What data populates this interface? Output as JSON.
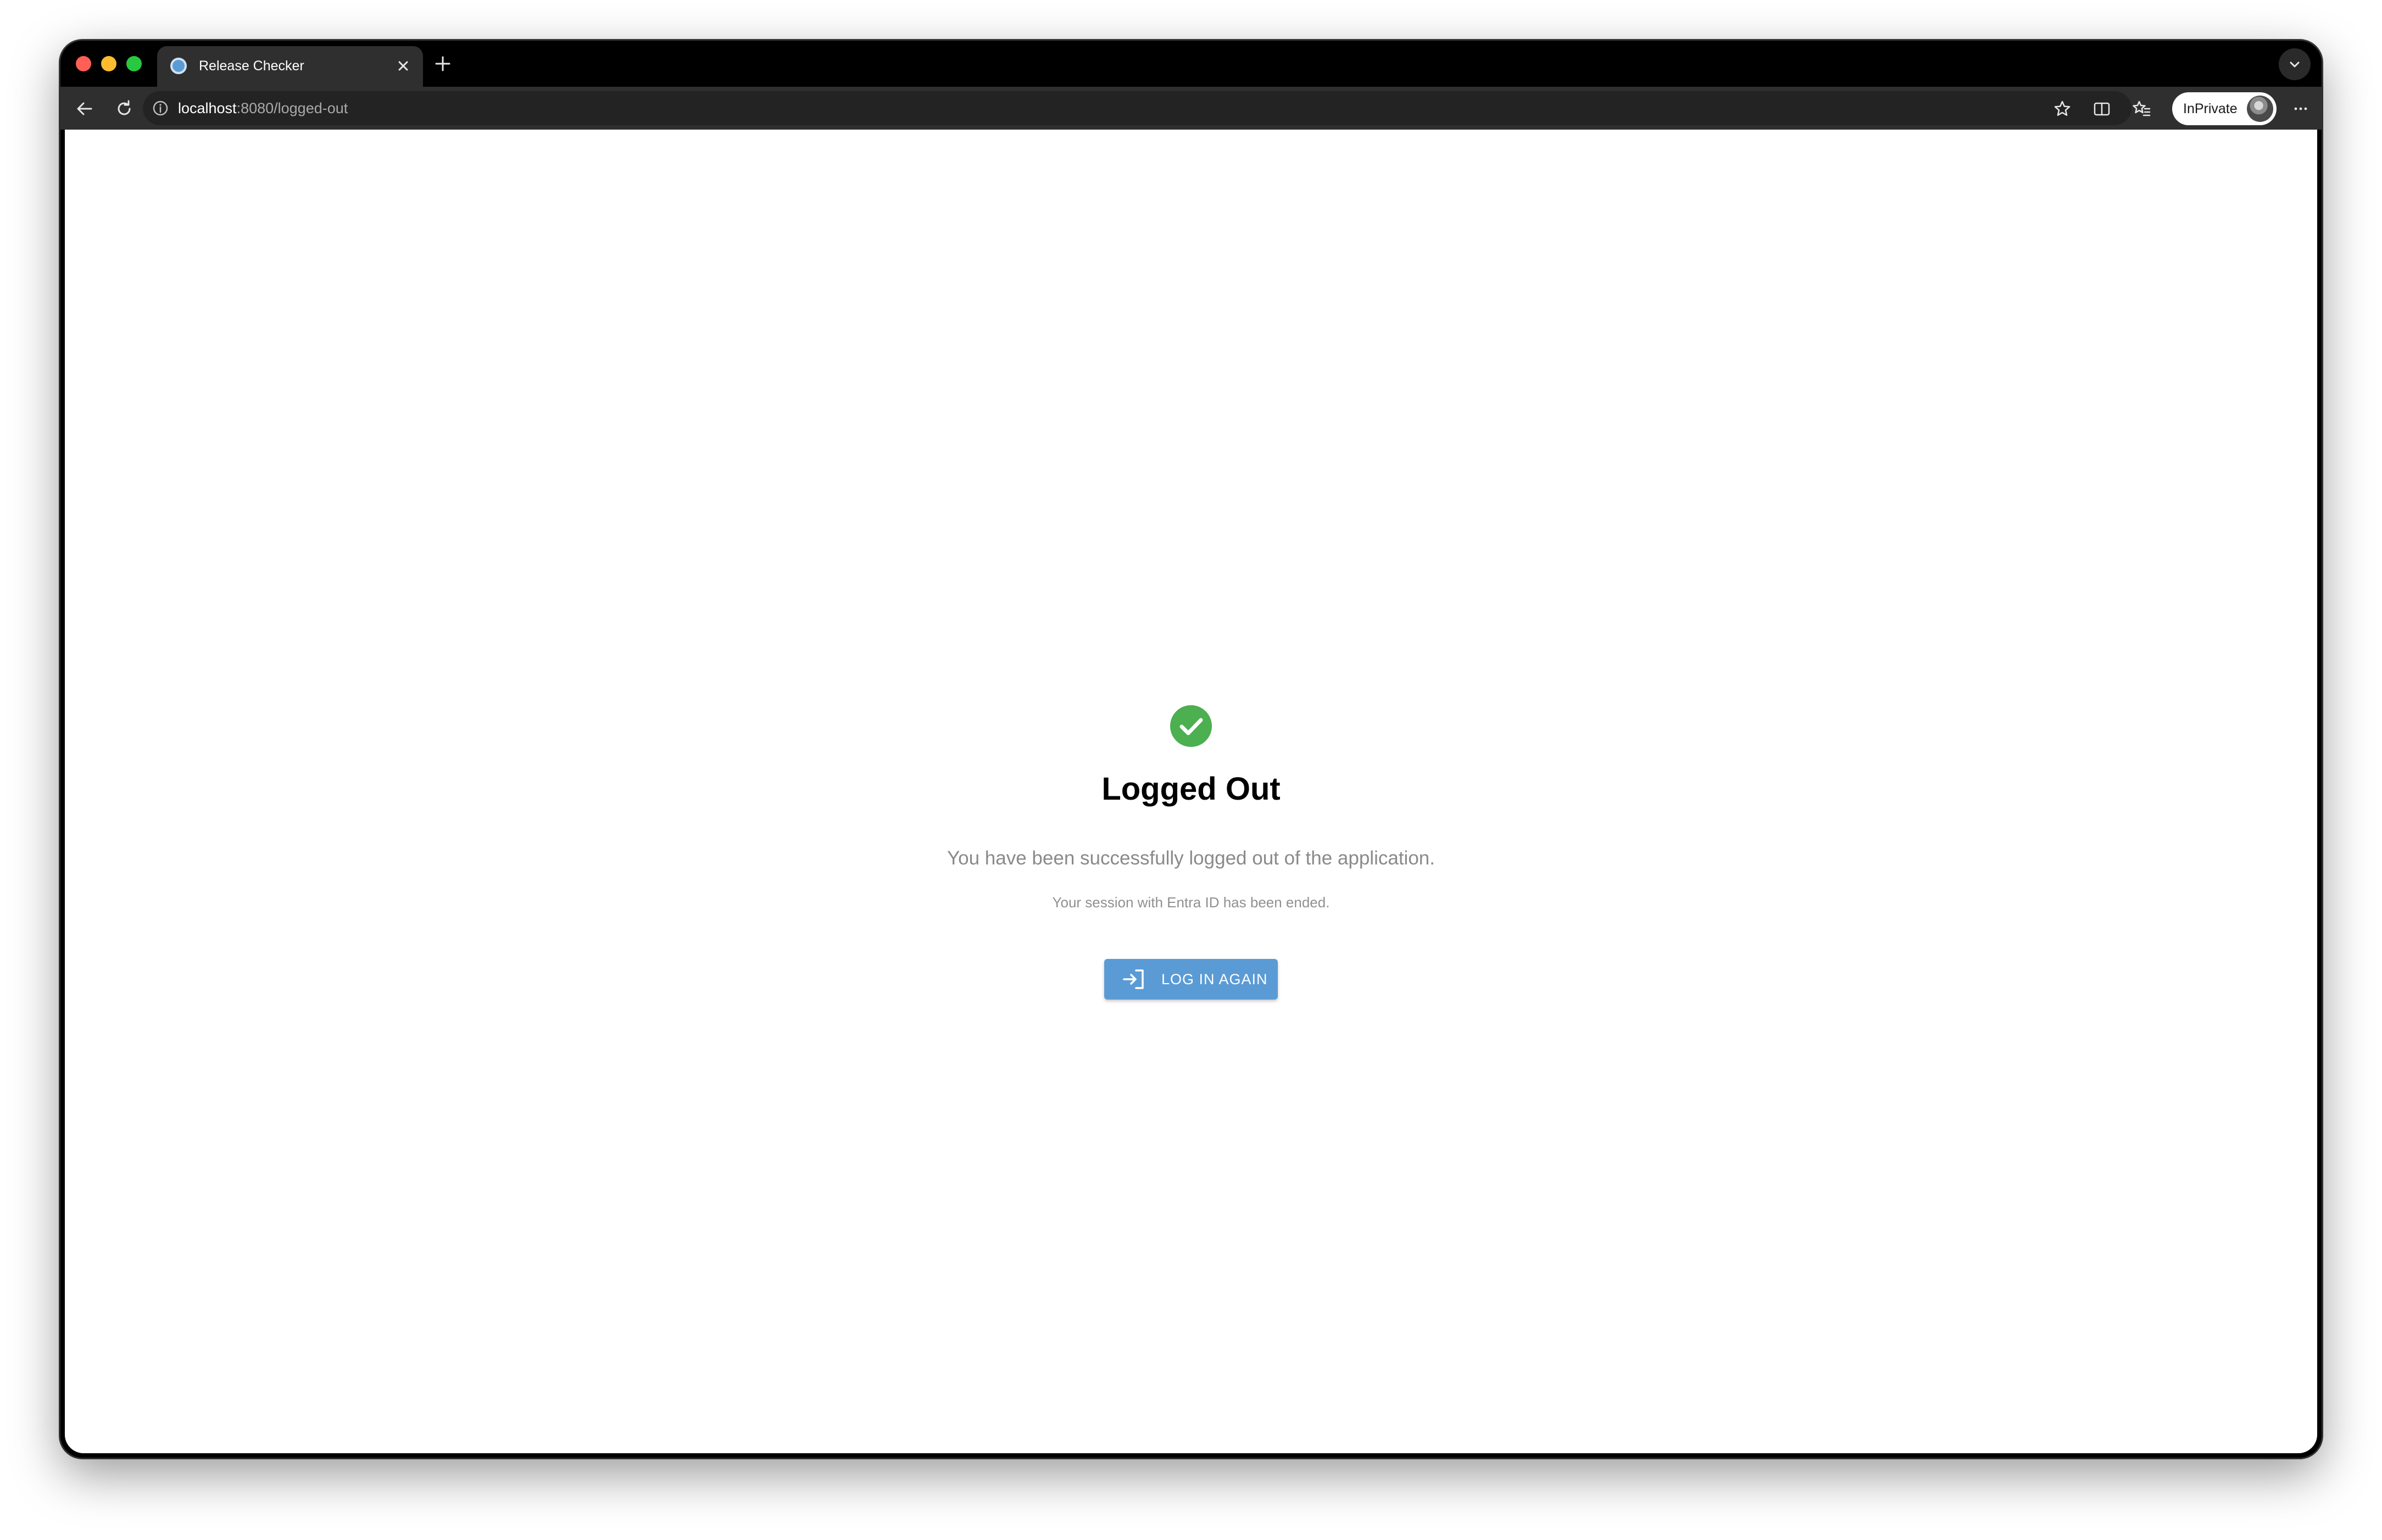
{
  "browser": {
    "tab": {
      "title": "Release Checker",
      "favicon": "app-globe-icon"
    },
    "address_bar": {
      "host": "localhost",
      "path": ":8080/logged-out"
    },
    "profile": {
      "label": "InPrivate"
    },
    "icons": {
      "back": "arrow-left-icon",
      "reload": "reload-icon",
      "site_info": "info-icon",
      "favorite": "star-icon",
      "split_screen": "split-screen-icon",
      "favorites": "favorites-icon",
      "more": "more-icon",
      "close_tab": "close-icon",
      "new_tab": "plus-icon",
      "tab_actions": "chevron-down-icon"
    }
  },
  "page": {
    "status_icon": "check-circle-icon",
    "title": "Logged Out",
    "message": "You have been successfully logged out of the application.",
    "note": "Your session with Entra ID has been ended.",
    "login_button": {
      "label": "LOG IN AGAIN",
      "icon": "login-icon"
    }
  },
  "colors": {
    "success_green": "#4caf50",
    "button_blue": "#5b9bd5",
    "muted_text": "#8a8a8a"
  }
}
